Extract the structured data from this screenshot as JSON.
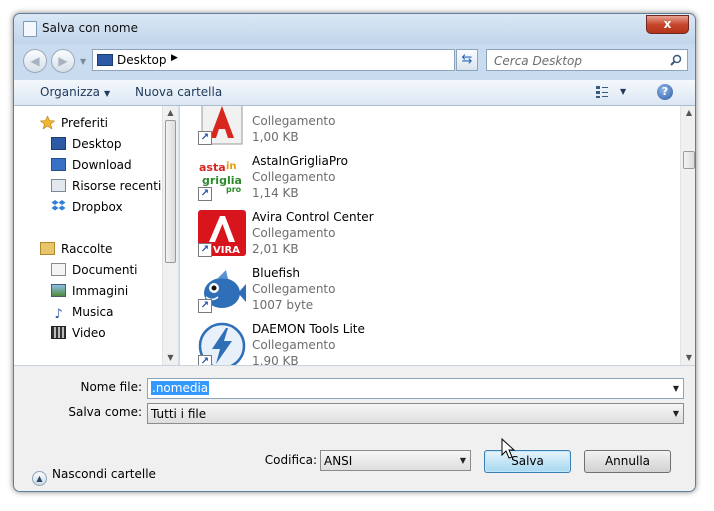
{
  "window": {
    "title": "Salva con nome",
    "close_glyph": "x"
  },
  "address": {
    "location": "Desktop",
    "search_placeholder": "Cerca Desktop"
  },
  "toolbar": {
    "organize_label": "Organizza",
    "new_folder_label": "Nuova cartella",
    "help_glyph": "?"
  },
  "navigation": {
    "favorites": {
      "label": "Preferiti",
      "items": [
        {
          "label": "Desktop",
          "icon": "desktop-icon"
        },
        {
          "label": "Download",
          "icon": "download-icon"
        },
        {
          "label": "Risorse recenti",
          "icon": "recent-places-icon"
        },
        {
          "label": "Dropbox",
          "icon": "dropbox-icon"
        }
      ]
    },
    "libraries": {
      "label": "Raccolte",
      "items": [
        {
          "label": "Documenti",
          "icon": "documents-icon"
        },
        {
          "label": "Immagini",
          "icon": "pictures-icon"
        },
        {
          "label": "Musica",
          "icon": "music-icon"
        },
        {
          "label": "Video",
          "icon": "video-icon"
        }
      ]
    }
  },
  "files": [
    {
      "name": "",
      "type": "Collegamento",
      "size": "1,00 KB",
      "icon": "adobe-icon"
    },
    {
      "name": "AstaInGrigliaPro",
      "type": "Collegamento",
      "size": "1,14 KB",
      "icon": "astaingriglia-icon",
      "logo_text": [
        "asta",
        "in",
        "griglia",
        "pro"
      ]
    },
    {
      "name": "Avira Control Center",
      "type": "Collegamento",
      "size": "2,01 KB",
      "icon": "avira-icon",
      "logo_text": "VIRA"
    },
    {
      "name": "Bluefish",
      "type": "Collegamento",
      "size": "1007 byte",
      "icon": "bluefish-icon"
    },
    {
      "name": "DAEMON Tools Lite",
      "type": "Collegamento",
      "size": "1,90 KB",
      "icon": "daemon-tools-icon"
    }
  ],
  "form": {
    "filename_label": "Nome file:",
    "filename_value": ".nomedia",
    "save_as_label": "Salva come:",
    "save_as_value": "Tutti i file",
    "encoding_label": "Codifica:",
    "encoding_value": "ANSI"
  },
  "footer": {
    "hide_folders_label": "Nascondi cartelle",
    "save_label": "Salva",
    "cancel_label": "Annulla"
  },
  "colors": {
    "accent": "#3399ff",
    "window_frame": "#c5d9ee",
    "close_button": "#c7462c"
  }
}
